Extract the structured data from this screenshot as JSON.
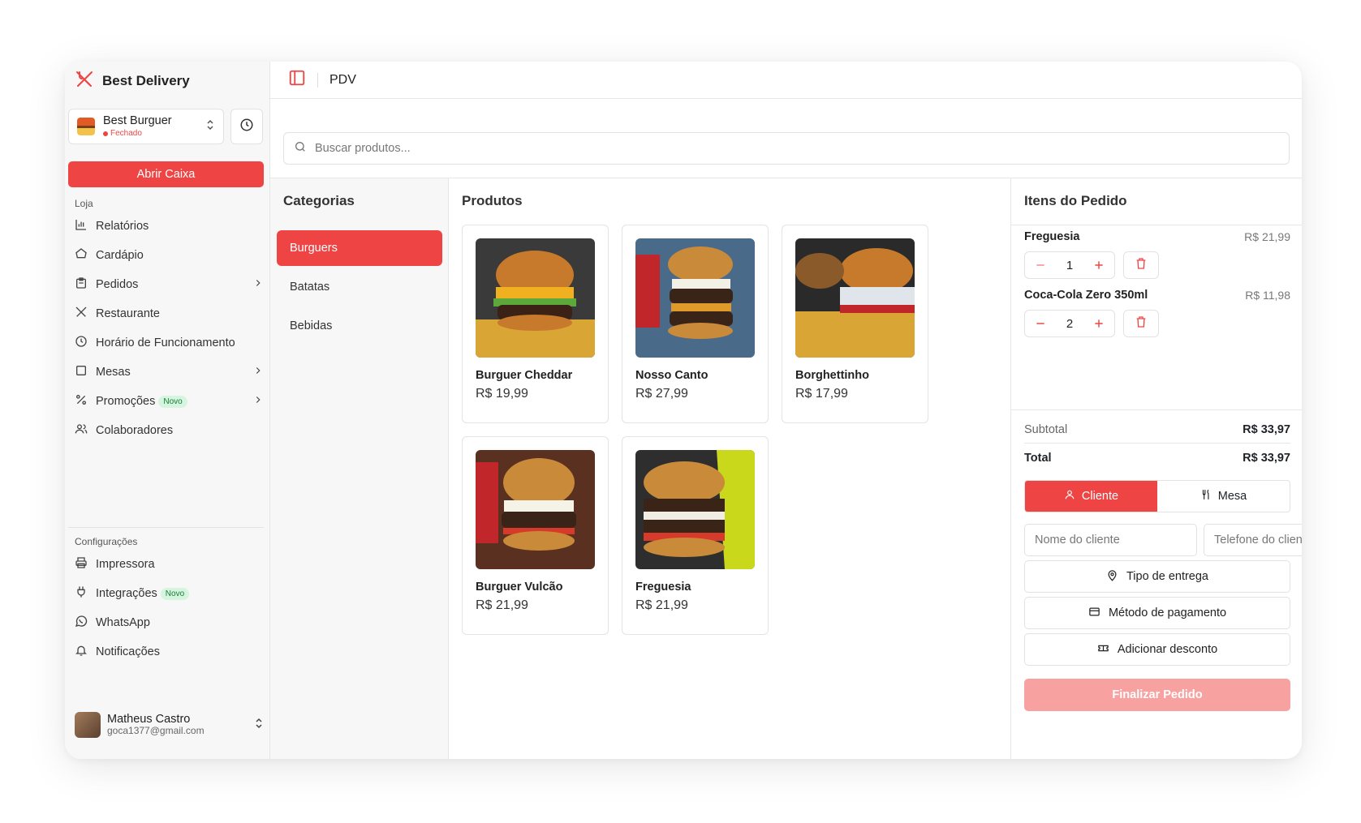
{
  "brand": {
    "name": "Best Delivery"
  },
  "store": {
    "name": "Best Burguer",
    "status": "Fechado"
  },
  "sidebar": {
    "open_cash_label": "Abrir Caixa",
    "store_section": "Loja",
    "items": [
      {
        "label": "Relatórios",
        "icon": "chart-icon"
      },
      {
        "label": "Cardápio",
        "icon": "menu-book-icon"
      },
      {
        "label": "Pedidos",
        "icon": "clipboard-icon"
      },
      {
        "label": "Restaurante",
        "icon": "utensils-icon"
      },
      {
        "label": "Horário de Funcionamento",
        "icon": "clock-icon"
      },
      {
        "label": "Mesas",
        "icon": "square-icon"
      },
      {
        "label": "Promoções",
        "icon": "percent-icon",
        "badge": "Novo"
      },
      {
        "label": "Colaboradores",
        "icon": "users-icon"
      }
    ],
    "config_section": "Configurações",
    "config_items": [
      {
        "label": "Impressora",
        "icon": "printer-icon"
      },
      {
        "label": "Integrações",
        "icon": "plug-icon",
        "badge": "Novo"
      },
      {
        "label": "WhatsApp",
        "icon": "whatsapp-icon"
      },
      {
        "label": "Notificações",
        "icon": "bell-icon"
      }
    ]
  },
  "user": {
    "name": "Matheus Castro",
    "email": "goca1377@gmail.com"
  },
  "header": {
    "title": "PDV"
  },
  "search": {
    "placeholder": "Buscar produtos..."
  },
  "categories": {
    "title": "Categorias",
    "items": [
      "Burguers",
      "Batatas",
      "Bebidas"
    ],
    "active": "Burguers"
  },
  "products": {
    "title": "Produtos",
    "items": [
      {
        "name": "Burguer Cheddar",
        "price": "R$ 19,99"
      },
      {
        "name": "Nosso Canto",
        "price": "R$ 27,99"
      },
      {
        "name": "Borghettinho",
        "price": "R$ 17,99"
      },
      {
        "name": "Burguer Vulcão",
        "price": "R$ 21,99"
      },
      {
        "name": "Freguesia",
        "price": "R$ 21,99"
      }
    ]
  },
  "order": {
    "title": "Itens do Pedido",
    "items": [
      {
        "name": "Freguesia",
        "price": "R$ 21,99",
        "qty": "1"
      },
      {
        "name": "Coca-Cola Zero 350ml",
        "price": "R$ 11,98",
        "qty": "2"
      }
    ],
    "subtotal_label": "Subtotal",
    "subtotal": "R$ 33,97",
    "total_label": "Total",
    "total": "R$ 33,97",
    "tabs": {
      "client": "Cliente",
      "table": "Mesa"
    },
    "client_name_placeholder": "Nome do cliente",
    "client_phone_placeholder": "Telefone do cliente",
    "delivery_type": "Tipo de entrega",
    "payment_method": "Método de pagamento",
    "discount": "Adicionar desconto",
    "finish": "Finalizar Pedido"
  },
  "colors": {
    "accent": "#ef4444",
    "accent_disabled": "#f7a1a1",
    "badge_bg": "#d6f5df"
  }
}
